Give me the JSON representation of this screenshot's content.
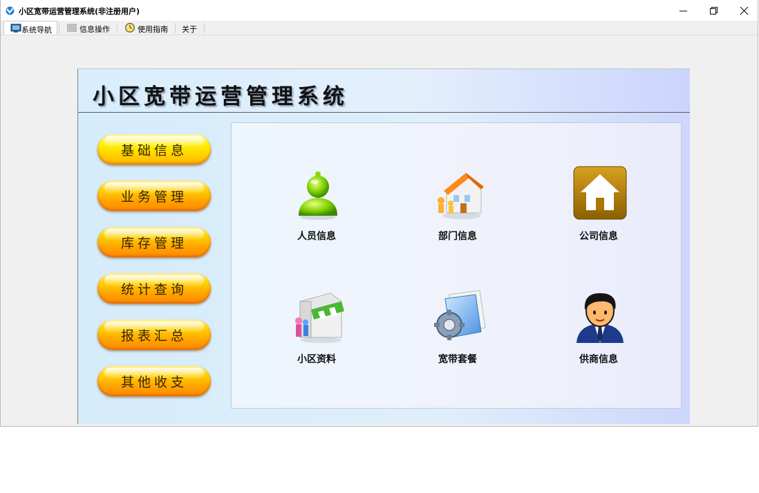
{
  "window": {
    "title": "小区宽带运营管理系统(非注册用户)"
  },
  "menubar": {
    "items": [
      {
        "label": "系统导航",
        "icon": "monitor-icon"
      },
      {
        "label": "信息操作",
        "icon": "grid-icon"
      },
      {
        "label": "使用指南",
        "icon": "clock-icon"
      },
      {
        "label": "关于"
      }
    ]
  },
  "panel": {
    "title": "小区宽带运营管理系统",
    "nav": [
      "基础信息",
      "业务管理",
      "库存管理",
      "统计查询",
      "报表汇总",
      "其他收支"
    ],
    "tiles": [
      {
        "label": "人员信息",
        "icon": "person-icon"
      },
      {
        "label": "部门信息",
        "icon": "building-icon"
      },
      {
        "label": "公司信息",
        "icon": "home-icon"
      },
      {
        "label": "小区资料",
        "icon": "shop-icon"
      },
      {
        "label": "宽带套餐",
        "icon": "gear-folder-icon"
      },
      {
        "label": "供商信息",
        "icon": "businessman-icon"
      }
    ]
  },
  "colors": {
    "nav_orange": "#ff9a00",
    "nav_yellow": "#ffe000",
    "panel_bg": "#dcecfb"
  }
}
